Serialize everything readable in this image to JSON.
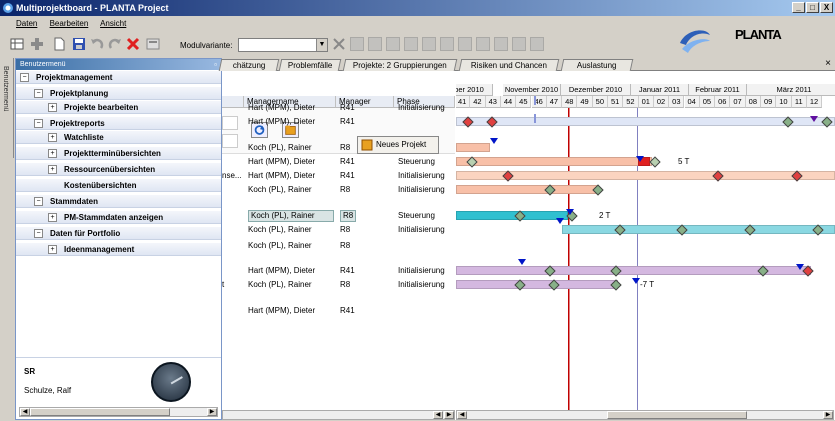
{
  "window": {
    "title": "Multiprojektboard - PLANTA Project",
    "buttons": [
      "_",
      "□",
      "X"
    ]
  },
  "menu": [
    "Daten",
    "Bearbeiten",
    "Ansicht"
  ],
  "toolbar": {
    "modulvariante_label": "Modulvariante:",
    "modulvariante_value": ""
  },
  "logo": {
    "text": "PLANTA"
  },
  "vtab_label": "Benutzermenü",
  "sidebar": {
    "title": "Benutzermenü",
    "items": [
      {
        "label": "Projektmanagement",
        "expander": "−",
        "level": 0
      },
      {
        "label": "Projektplanung",
        "expander": "−",
        "level": 1
      },
      {
        "label": "Projekte bearbeiten",
        "expander": "+",
        "level": 2
      },
      {
        "label": "Projektreports",
        "expander": "−",
        "level": 1
      },
      {
        "label": "Watchliste",
        "expander": "+",
        "level": 2
      },
      {
        "label": "Projektterminübersichten",
        "expander": "+",
        "level": 2
      },
      {
        "label": "Ressourcenübersichten",
        "expander": "+",
        "level": 2
      },
      {
        "label": "Kostenübersichten",
        "expander": "",
        "level": 2
      },
      {
        "label": "Stammdaten",
        "expander": "−",
        "level": 1
      },
      {
        "label": "PM-Stammdaten anzeigen",
        "expander": "+",
        "level": 2
      },
      {
        "label": "Daten für Portfolio",
        "expander": "−",
        "level": 1
      },
      {
        "label": "Ideenmanagement",
        "expander": "+",
        "level": 2
      }
    ],
    "user_code": "SR",
    "user_name": "Schulze, Ralf"
  },
  "tabs": [
    "chätzung",
    "Problemfälle",
    "Projekte: 2 Gruppierungen",
    "Risiken und Chancen",
    "Auslastung"
  ],
  "grid": {
    "columns": [
      "Managername",
      "Manager",
      "Phase"
    ],
    "new_project_label": "Neues Projekt",
    "rows": [
      {
        "prefix": "",
        "manager_name": "Hart (MPM), Dieter",
        "manager": "R41",
        "phase": "Initialisierung",
        "highlight": false
      },
      {
        "prefix": "",
        "manager_name": "Hart (MPM), Dieter",
        "manager": "R41",
        "phase": "",
        "highlight": false
      },
      {
        "prefix": "",
        "manager_name": "Koch (PL), Rainer",
        "manager": "R8",
        "phase": "",
        "highlight": false
      },
      {
        "prefix": "",
        "manager_name": "Hart (MPM), Dieter",
        "manager": "R41",
        "phase": "Steuerung",
        "highlight": false
      },
      {
        "prefix": "nse...",
        "manager_name": "Hart (MPM), Dieter",
        "manager": "R41",
        "phase": "Initialisierung",
        "highlight": false
      },
      {
        "prefix": "",
        "manager_name": "Koch (PL), Rainer",
        "manager": "R8",
        "phase": "Initialisierung",
        "highlight": false
      },
      {
        "prefix": "",
        "manager_name": "Koch (PL), Rainer",
        "manager": "R8",
        "phase": "Steuerung",
        "highlight": true
      },
      {
        "prefix": "",
        "manager_name": "Koch (PL), Rainer",
        "manager": "R8",
        "phase": "Initialisierung",
        "highlight": false
      },
      {
        "prefix": "",
        "manager_name": "Koch (PL), Rainer",
        "manager": "R8",
        "phase": "",
        "highlight": false
      },
      {
        "prefix": "",
        "manager_name": "Hart (MPM), Dieter",
        "manager": "R41",
        "phase": "Initialisierung",
        "highlight": false
      },
      {
        "prefix": "t",
        "manager_name": "Koch (PL), Rainer",
        "manager": "R8",
        "phase": "Initialisierung",
        "highlight": false
      },
      {
        "prefix": "",
        "manager_name": "Hart (MPM), Dieter",
        "manager": "R41",
        "phase": "",
        "highlight": false
      }
    ]
  },
  "gantt": {
    "months": [
      "ber 2010",
      "November 2010",
      "Dezember 2010",
      "Januar 2011",
      "Februar 2011",
      "März 2011"
    ],
    "weeks": [
      "41",
      "42",
      "43",
      "44",
      "45",
      "46",
      "47",
      "48",
      "49",
      "50",
      "51",
      "52",
      "01",
      "02",
      "03",
      "04",
      "05",
      "06",
      "07",
      "08",
      "09",
      "10",
      "11",
      "12"
    ],
    "labels": {
      "r4": "5 T",
      "r7": "2 T",
      "r11": "-7 T"
    }
  }
}
